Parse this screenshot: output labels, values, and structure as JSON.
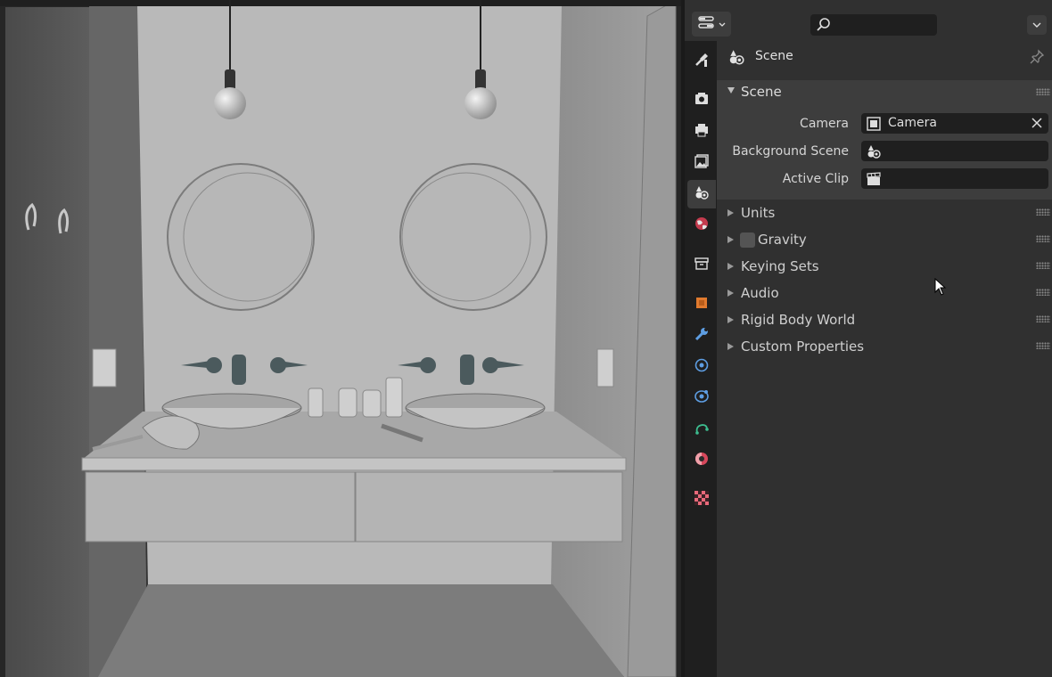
{
  "header": {
    "editor_type_icon": "properties-editor-icon",
    "search_placeholder": "",
    "search_icon": "magnifier-icon",
    "options_icon": "chevron-down-icon"
  },
  "tabs": [
    {
      "name": "tool-tab",
      "icon": "wrench-screwdriver-icon",
      "active": false
    },
    {
      "name": "render-tab",
      "icon": "camera-back-icon",
      "active": false
    },
    {
      "name": "output-tab",
      "icon": "printer-icon",
      "active": false
    },
    {
      "name": "view-layer-tab",
      "icon": "images-icon",
      "active": false
    },
    {
      "name": "scene-tab",
      "icon": "scene-icon",
      "active": true
    },
    {
      "name": "world-tab",
      "icon": "world-icon",
      "active": false
    },
    {
      "name": "collection-tab",
      "icon": "collection-box-icon",
      "active": false
    },
    {
      "name": "object-tab",
      "icon": "object-square-icon",
      "active": false
    },
    {
      "name": "modifiers-tab",
      "icon": "wrench-icon",
      "active": false
    },
    {
      "name": "particles-tab",
      "icon": "particles-icon",
      "active": false
    },
    {
      "name": "physics-tab",
      "icon": "physics-orbit-icon",
      "active": false
    },
    {
      "name": "constraints-tab",
      "icon": "constraint-icon",
      "active": false
    },
    {
      "name": "material-tab",
      "icon": "material-sphere-icon",
      "active": false
    },
    {
      "name": "texture-tab",
      "icon": "checker-texture-icon",
      "active": false
    }
  ],
  "context": {
    "title": "Scene",
    "icon": "scene-icon",
    "pin_icon": "pin-icon"
  },
  "scene_panel": {
    "label": "Scene",
    "expanded": true,
    "properties": [
      {
        "label": "Camera",
        "value": "Camera",
        "icon": "camera-object-icon",
        "clearable": true
      },
      {
        "label": "Background Scene",
        "value": "",
        "icon": "scene-icon",
        "clearable": false
      },
      {
        "label": "Active Clip",
        "value": "",
        "icon": "clip-icon",
        "clearable": false
      }
    ]
  },
  "panels": [
    {
      "label": "Units",
      "has_checkbox": false
    },
    {
      "label": "Gravity",
      "has_checkbox": true,
      "checked": false
    },
    {
      "label": "Keying Sets",
      "has_checkbox": false
    },
    {
      "label": "Audio",
      "has_checkbox": false
    },
    {
      "label": "Rigid Body World",
      "has_checkbox": false
    },
    {
      "label": "Custom Properties",
      "has_checkbox": false
    }
  ],
  "colors": {
    "panel_bg": "#303030",
    "subpanel_bg": "#3d3d3d",
    "field_bg": "#1f1f1f",
    "viewport_wall": "#b8b8b8"
  }
}
